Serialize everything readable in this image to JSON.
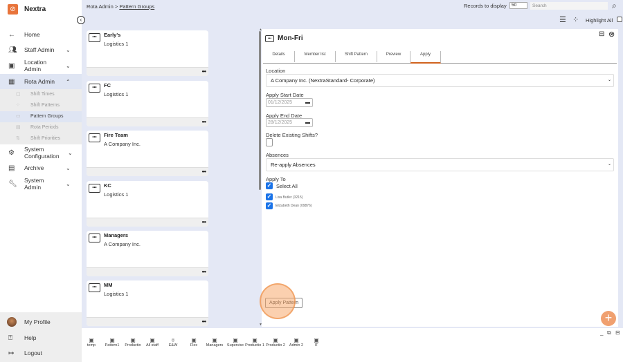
{
  "app": {
    "name": "Nextra",
    "brand_color": "#e8743b"
  },
  "sidebar": {
    "items": [
      {
        "label": "Home",
        "icon": "arrow-left-icon"
      },
      {
        "label": "Staff Admin",
        "icon": "users-icon"
      },
      {
        "label": "Location Admin",
        "icon": "id-badge-icon"
      },
      {
        "label": "Rota Admin",
        "icon": "calendar-icon"
      },
      {
        "label": "System Configuration",
        "icon": "gear-icon"
      },
      {
        "label": "Archive",
        "icon": "archive-icon"
      },
      {
        "label": "System Admin",
        "icon": "wrench-icon"
      }
    ],
    "sub_items": [
      {
        "label": "Shift Times"
      },
      {
        "label": "Shift Patterns"
      },
      {
        "label": "Pattern Groups"
      },
      {
        "label": "Rota Periods"
      },
      {
        "label": "Shift Priorities"
      }
    ],
    "bottom": [
      {
        "label": "My Profile"
      },
      {
        "label": "Help"
      },
      {
        "label": "Logout"
      }
    ]
  },
  "header": {
    "breadcrumb_parent": "Rota Admin",
    "breadcrumb_sep": ">",
    "breadcrumb_current": "Pattern Groups",
    "records_label": "Records to display",
    "records_value": "50",
    "search_placeholder": "Search",
    "highlight_label": "Highlight All"
  },
  "cards": [
    {
      "title": "Early's",
      "subtitle": "Logistics 1"
    },
    {
      "title": "FC",
      "subtitle": "Logistics 1"
    },
    {
      "title": "Fire Team",
      "subtitle": "A Company Inc."
    },
    {
      "title": "KC",
      "subtitle": "Logistics 1"
    },
    {
      "title": "Managers",
      "subtitle": "A Company Inc."
    },
    {
      "title": "MM",
      "subtitle": "Logistics 1"
    }
  ],
  "card_menu": "•••",
  "panel": {
    "title": "Mon-Fri",
    "tabs": [
      "Details",
      "Member list",
      "Shift Pattern",
      "Preview",
      "Apply"
    ],
    "active_tab": "Apply",
    "location_label": "Location",
    "location_value": "A Company Inc. (NextraStandard- Corporate)",
    "start_label": "Apply Start Date",
    "start_value": "01/12/2025",
    "end_label": "Apply End Date",
    "end_value": "28/12/2025",
    "delete_label": "Delete Existing Shifts?",
    "delete_checked": false,
    "absences_label": "Absences",
    "absences_value": "Re-apply Absences",
    "apply_to_label": "Apply To",
    "select_all_label": "Select All",
    "members": [
      {
        "label": "Lisa Butler (3215)",
        "checked": true
      },
      {
        "label": "Elizabeth Dean (09876)",
        "checked": true
      }
    ],
    "apply_button": "Apply Pattern"
  },
  "groups": [
    {
      "label": "temp",
      "icon": "id-badge-icon"
    },
    {
      "label": "Pattern1",
      "icon": "id-badge-icon"
    },
    {
      "label": "Productio",
      "icon": "id-badge-icon"
    },
    {
      "label": "All staff",
      "icon": "id-badge-icon"
    },
    {
      "label": "E&W",
      "icon": "location-pin-icon"
    },
    {
      "label": "Flex",
      "icon": "id-badge-icon"
    },
    {
      "label": "Managers",
      "icon": "id-badge-icon"
    },
    {
      "label": "Supervisc",
      "icon": "id-badge-icon"
    },
    {
      "label": "Productio 1",
      "icon": "id-badge-icon"
    },
    {
      "label": "Productio 2",
      "icon": "id-badge-icon"
    },
    {
      "label": "Admin 2",
      "icon": "id-badge-icon"
    },
    {
      "label": "IT",
      "icon": "id-badge-icon"
    }
  ],
  "colors": {
    "accent": "#d0621d",
    "checkbox": "#1a73e8",
    "background": "#e4e8f5",
    "fab": "#f0a070"
  }
}
